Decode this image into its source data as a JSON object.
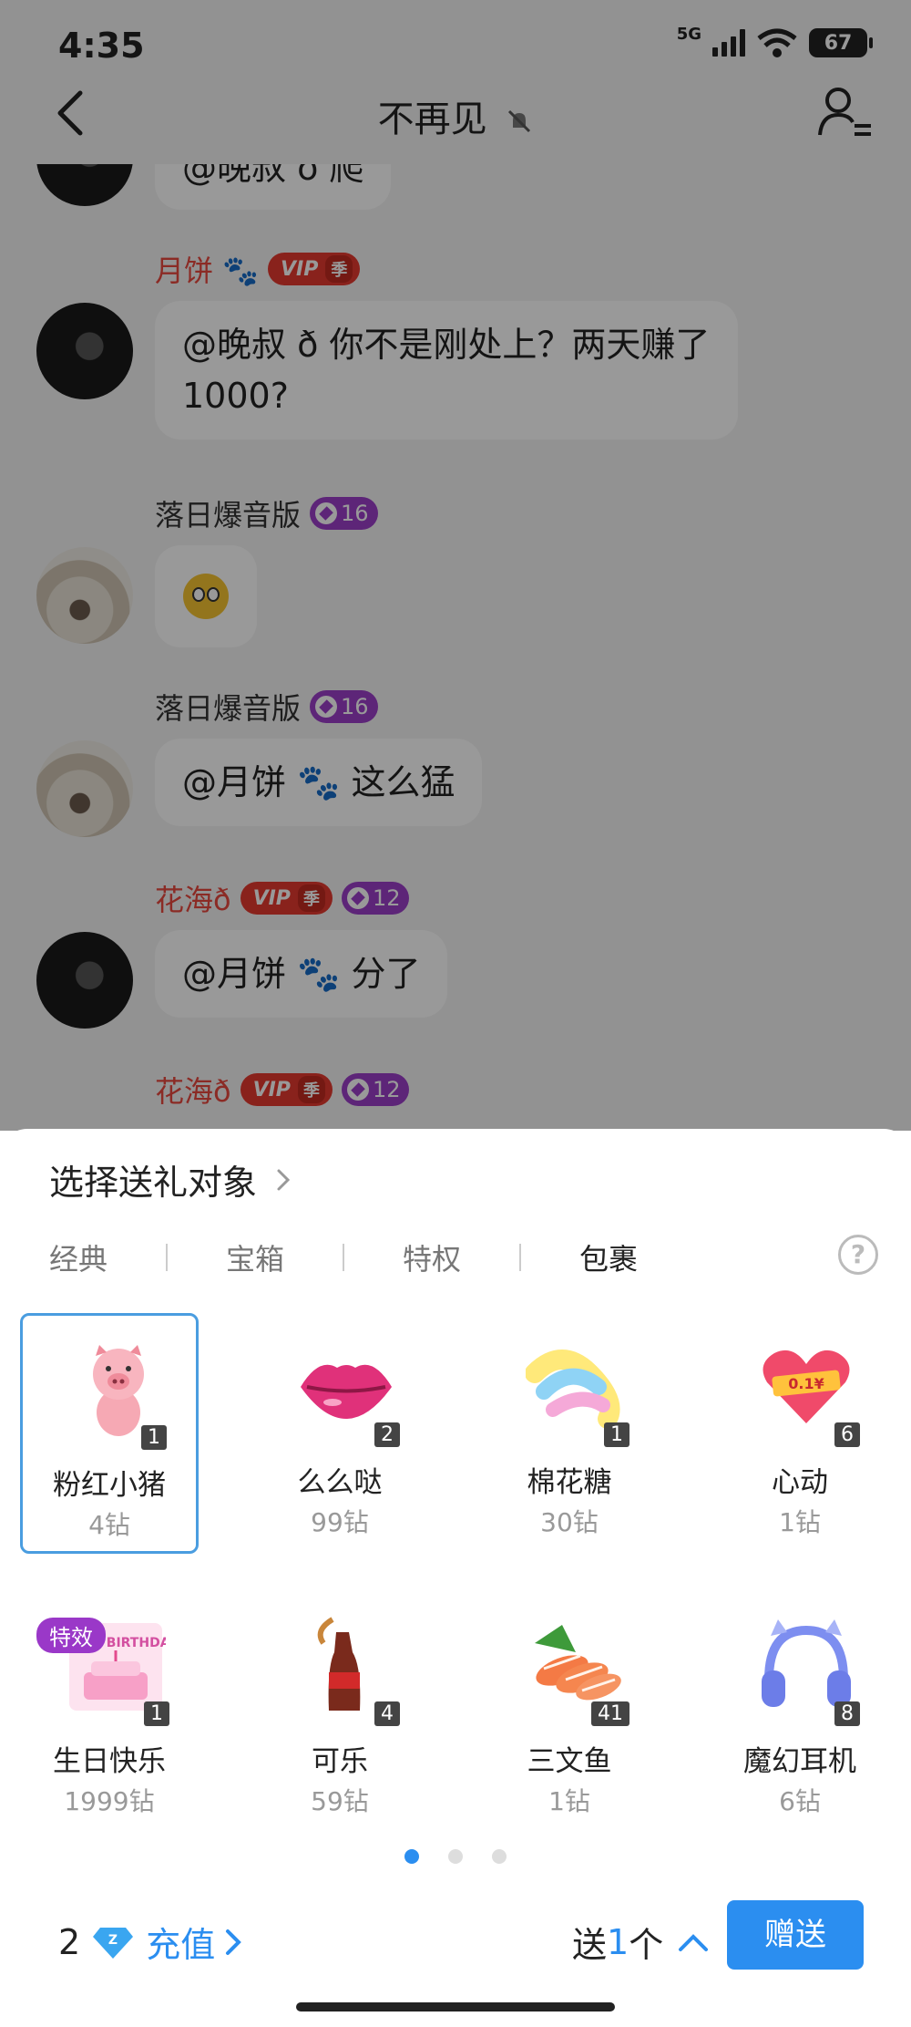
{
  "status_bar": {
    "time": "4:35",
    "network": "5G",
    "battery": "67"
  },
  "header": {
    "title": "不再见",
    "back_icon": "back-arrow-icon",
    "mute_icon": "bell-muted-icon",
    "members_icon": "group-members-icon"
  },
  "messages": [
    {
      "sender": "",
      "text": "@晚叔 ð 爬"
    },
    {
      "sender": "月饼 🐾",
      "vip": "VIP",
      "vip_tag": "季",
      "text": "@晚叔 ð 你不是刚处上？两天赚了1000?"
    },
    {
      "sender": "落日爆音版",
      "level": "16",
      "text": "😳"
    },
    {
      "sender": "落日爆音版",
      "level": "16",
      "text": "@月饼 🐾 这么猛"
    },
    {
      "sender": "花海ð",
      "vip": "VIP",
      "vip_tag": "季",
      "level": "12",
      "text": "@月饼 🐾 分了"
    },
    {
      "sender": "花海ð",
      "vip": "VIP",
      "vip_tag": "季",
      "level": "12"
    }
  ],
  "gift_sheet": {
    "target_label": "选择送礼对象",
    "tabs": [
      "经典",
      "宝箱",
      "特权",
      "包裹"
    ],
    "active_tab": "包裹",
    "gifts": [
      {
        "name": "粉红小猪",
        "price": "4钻",
        "count": "1",
        "icon": "pig-icon",
        "selected": true
      },
      {
        "name": "么么哒",
        "price": "99钻",
        "count": "2",
        "icon": "lips-icon"
      },
      {
        "name": "棉花糖",
        "price": "30钻",
        "count": "1",
        "icon": "marshmallow-icon"
      },
      {
        "name": "心动",
        "price": "1钻",
        "count": "6",
        "icon": "heart-icon",
        "badge_text": "0.1¥"
      },
      {
        "name": "生日快乐",
        "price": "1999钻",
        "count": "1",
        "icon": "birthday-cake-icon",
        "tag": "特效",
        "art_text": "HAPPY BIRTHDAY"
      },
      {
        "name": "可乐",
        "price": "59钻",
        "count": "4",
        "icon": "cola-bottle-icon"
      },
      {
        "name": "三文鱼",
        "price": "1钻",
        "count": "41",
        "icon": "salmon-icon"
      },
      {
        "name": "魔幻耳机",
        "price": "6钻",
        "count": "8",
        "icon": "headphones-icon"
      }
    ],
    "page_dots": 3,
    "current_page": 1,
    "balance": "2",
    "recharge_label": "充值",
    "qty_prefix": "送",
    "qty_value": "1",
    "qty_suffix": "个",
    "send_label": "赠送"
  },
  "colors": {
    "accent": "#2b8ef0",
    "vip": "#e53a2f",
    "level": "#9b3fc8",
    "nick_red": "#e8483f"
  }
}
